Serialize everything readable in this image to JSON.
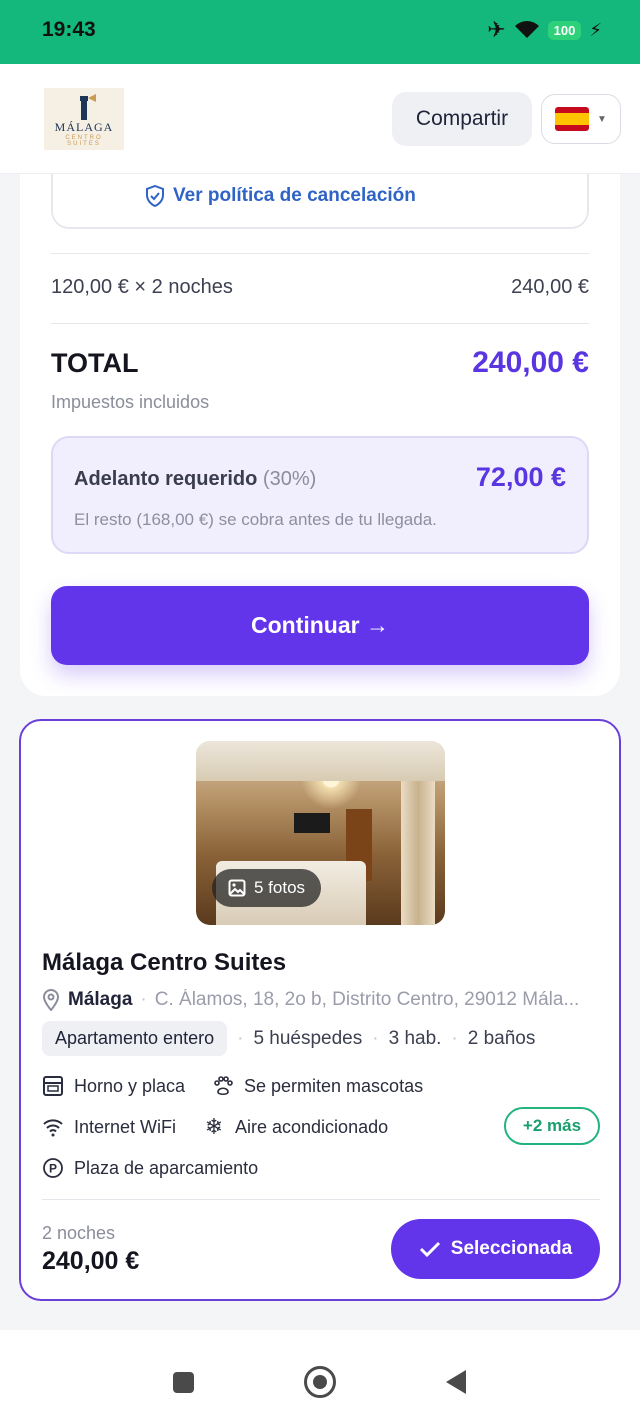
{
  "status_bar": {
    "time": "19:43",
    "battery": "100"
  },
  "header": {
    "logo_name": "MÁLAGA",
    "logo_sub1": "CENTRO",
    "logo_sub2": "SUITES",
    "share_label": "Compartir",
    "language_flag": "spain-flag-icon"
  },
  "summary": {
    "cancel_policy_link": "Ver política de cancelación",
    "nightly_line_label": "120,00 € × 2 noches",
    "nightly_line_value": "240,00 €",
    "total_label": "TOTAL",
    "total_value": "240,00 €",
    "tax_note": "Impuestos incluidos",
    "deposit_label": "Adelanto requerido",
    "deposit_pct": "(30%)",
    "deposit_value": "72,00 €",
    "deposit_note": "El resto (168,00 €) se cobra antes de tu llegada.",
    "continue_label": "Continuar →"
  },
  "apartment": {
    "photo_count": "5 fotos",
    "title": "Málaga Centro Suites",
    "city": "Málaga",
    "address": "C. Álamos, 18, 2o b, Distrito Centro, 29012 Mála...",
    "type": "Apartamento entero",
    "guests": "5 huéspedes",
    "rooms": "3 hab.",
    "baths": "2 baños",
    "amenities": [
      {
        "label": "Horno y placa",
        "icon": "oven-icon"
      },
      {
        "label": "Se permiten mascotas",
        "icon": "paw-icon"
      },
      {
        "label": "Internet WiFi",
        "icon": "wifi-icon"
      },
      {
        "label": "Aire acondicionado",
        "icon": "snowflake-icon"
      },
      {
        "label": "Plaza de aparcamiento",
        "icon": "parking-icon"
      }
    ],
    "more_label": "+2 más",
    "nights": "2 noches",
    "price": "240,00 €",
    "selected_label": "Seleccionada"
  },
  "colors": {
    "accent": "#6234ea",
    "status_bar": "#14b87c",
    "more_green": "#22b37e",
    "link_blue": "#2f63c6"
  }
}
